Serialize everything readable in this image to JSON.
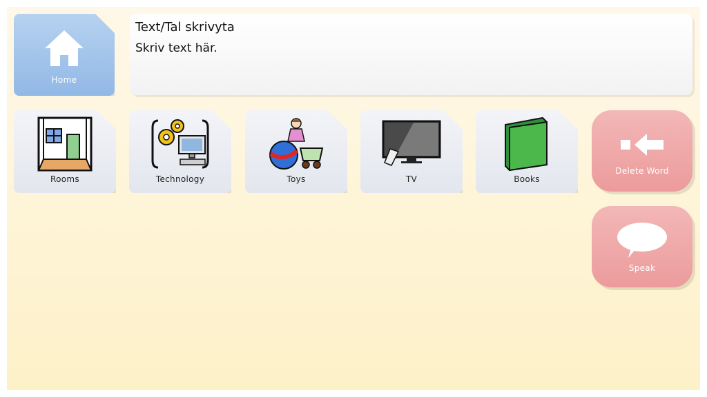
{
  "home": {
    "label": "Home",
    "icon": "home-icon"
  },
  "text_area": {
    "title": "Text/Tal skrivyta",
    "body": "Skriv text här."
  },
  "folders": [
    {
      "label": "Rooms",
      "icon": "room-icon"
    },
    {
      "label": "Technology",
      "icon": "technology-icon"
    },
    {
      "label": "Toys",
      "icon": "toys-icon"
    },
    {
      "label": "TV",
      "icon": "tv-icon"
    },
    {
      "label": "Books",
      "icon": "book-icon"
    }
  ],
  "actions": {
    "delete_word": {
      "label": "Delete Word",
      "icon": "delete-word-icon"
    },
    "speak": {
      "label": "Speak",
      "icon": "speech-bubble-icon"
    }
  },
  "colors": {
    "background_top": "#fff8e8",
    "background_bottom": "#fdf1c8",
    "home_tile": "#a4c5ec",
    "folder_tile": "#eceef4",
    "action_tile": "#efa8a8"
  }
}
